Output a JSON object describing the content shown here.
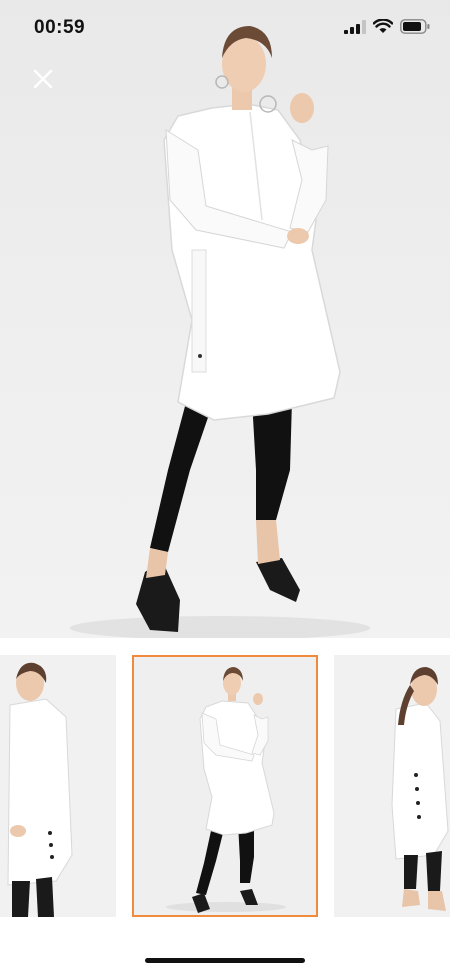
{
  "status_bar": {
    "time": "00:59",
    "icons": [
      "cellular-signal-icon",
      "wifi-icon",
      "battery-icon"
    ]
  },
  "toolbar": {
    "close_icon": "close-icon"
  },
  "gallery": {
    "selected_index": 1,
    "thumbnails": [
      "thumbnail-side-view",
      "thumbnail-front-view",
      "thumbnail-back-view"
    ],
    "accent_color": "#f08a3c"
  }
}
